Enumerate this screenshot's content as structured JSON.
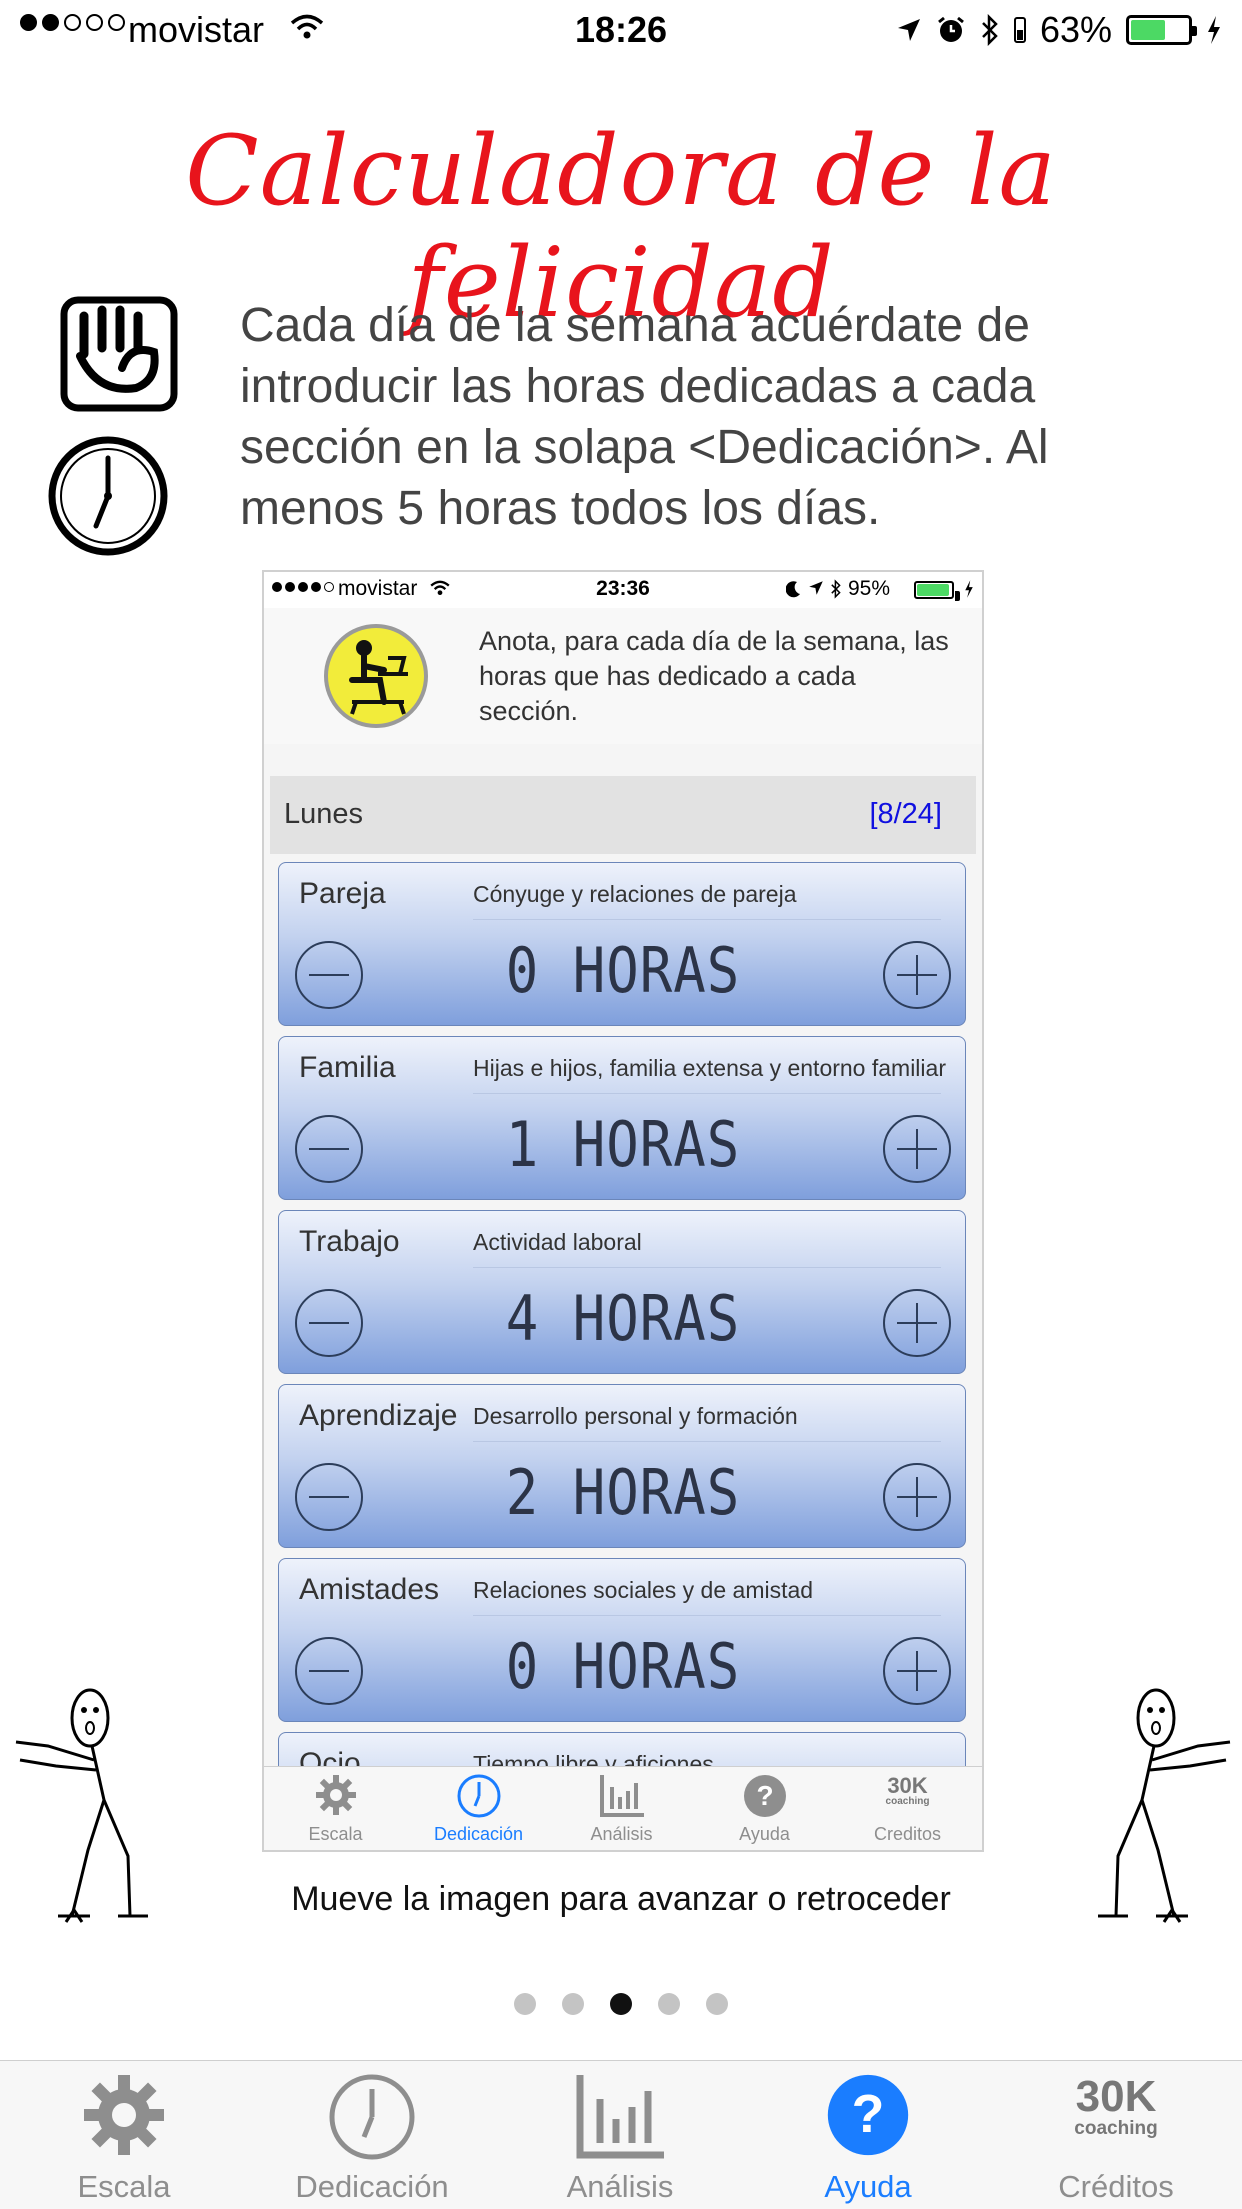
{
  "status_bar": {
    "carrier": "movistar",
    "time": "18:26",
    "battery": "63%",
    "battery_level": 0.63
  },
  "title": "Calculadora de la felicidad",
  "intro": "Cada día de la semana acuérdate de introducir las horas dedicadas a cada sección en la solapa <Dedicación>. Al menos 5 horas todos los días.",
  "screenshot": {
    "status_bar": {
      "carrier": "movistar",
      "time": "23:36",
      "battery": "95%",
      "battery_level": 0.95
    },
    "hint": "Anota, para cada día de la semana, las horas que has dedicado a cada sección.",
    "day": {
      "name": "Lunes",
      "total": "[8/24]"
    },
    "cards": [
      {
        "category": "Pareja",
        "description": "Cónyuge y relaciones de pareja",
        "value": "0 HORAS"
      },
      {
        "category": "Familia",
        "description": "Hijas e hijos, familia extensa y entorno familiar",
        "value": "1 HORAS"
      },
      {
        "category": "Trabajo",
        "description": "Actividad laboral",
        "value": "4 HORAS"
      },
      {
        "category": "Aprendizaje",
        "description": "Desarrollo personal y formación",
        "value": "2 HORAS"
      },
      {
        "category": "Amistades",
        "description": "Relaciones sociales y de amistad",
        "value": "0 HORAS"
      },
      {
        "category": "Ocio",
        "description": "Tiempo libre y aficiones",
        "value": ""
      }
    ],
    "tabs": [
      {
        "label": "Escala",
        "icon": "gear-icon"
      },
      {
        "label": "Dedicación",
        "icon": "clock-icon",
        "active": true
      },
      {
        "label": "Análisis",
        "icon": "bar-chart-icon"
      },
      {
        "label": "Ayuda",
        "icon": "question-icon"
      },
      {
        "label": "Creditos",
        "icon": "30k-logo-icon",
        "logo_text": "30K",
        "logo_sub": "coaching"
      }
    ]
  },
  "move_hint": "Mueve la imagen para avanzar o retroceder",
  "pager": {
    "count": 5,
    "active": 3
  },
  "tab_bar": [
    {
      "label": "Escala",
      "icon": "gear-icon"
    },
    {
      "label": "Dedicación",
      "icon": "clock-icon"
    },
    {
      "label": "Análisis",
      "icon": "bar-chart-icon"
    },
    {
      "label": "Ayuda",
      "icon": "question-icon",
      "active": true
    },
    {
      "label": "Créditos",
      "icon": "30k-logo-icon",
      "logo_text": "30K",
      "logo_sub": "coaching"
    }
  ],
  "colors": {
    "title": "#e8141c",
    "active_tab": "#1a7dff",
    "card_border": "#6b86b9"
  }
}
